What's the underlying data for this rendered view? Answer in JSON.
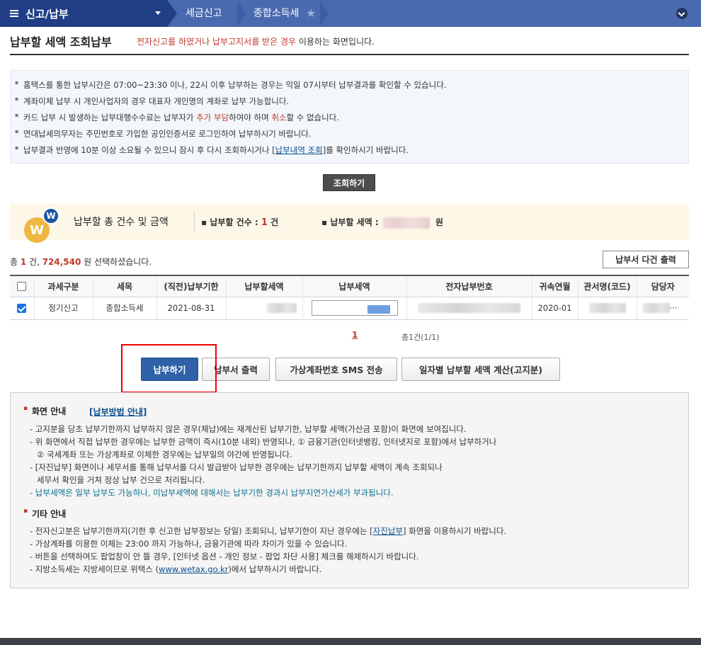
{
  "nav": {
    "main": "신고/납부",
    "crumbs": [
      "세금신고",
      "종합소득세"
    ]
  },
  "page": {
    "title": "납부할 세액 조회납부",
    "subtitle_red": "전자신고를 하였거나 납부고지서를 받은 경우",
    "subtitle_rest": " 이용하는 화면입니다."
  },
  "notice": {
    "line1": "홈택스를 통한 납부시간은 07:00~23:30 이나, 22시 이후 납부하는 경우는 익일 07시부터 납부결과를 확인할 수 있습니다.",
    "line2": "계좌이체 납부 시 개인사업자의 경우 대표자 개인명의 계좌로 납부 가능합니다.",
    "line3_a": "카드 납부 시 발생하는 납부대행수수료는 납부자가 ",
    "line3_b": "추가 부담",
    "line3_c": "하여야 하며 ",
    "line3_d": "취소",
    "line3_e": "할 수 없습니다.",
    "line4": "연대납세의무자는 주민번호로 가입한 공인인증서로 로그인하여 납부하시기 바랍니다.",
    "line5_a": "납부결과 반영에 10분 이상 소요될 수 있으니 잠시 후 다시 조회하시거나 [",
    "line5_link": "납부내역 조회",
    "line5_b": "]를 확인하시기 바랍니다."
  },
  "buttons": {
    "query": "조회하기",
    "multi_print": "납부서 다건 출력",
    "pay": "납부하기",
    "print": "납부서 출력",
    "sms": "가상계좌번호 SMS 전송",
    "daily_calc": "일자별 납부할 세액 계산(고지분)"
  },
  "summary": {
    "logo_big": "W",
    "logo_small": "W",
    "title": "납부할 총 건수 및 금액",
    "count_label": "납부할 건수 : ",
    "count_value": "1",
    "count_unit": " 건",
    "tax_label": "납부할 세액 : ",
    "tax_unit": "원"
  },
  "selection": {
    "prefix": "총 ",
    "count": "1",
    "mid": " 건, ",
    "amount": "724,540",
    "suffix": " 원 선택하셨습니다."
  },
  "table": {
    "headers": [
      "과세구분",
      "세목",
      "(직전)납부기한",
      "납부할세액",
      "납부세액",
      "전자납부번호",
      "귀속연월",
      "관서명(코드)",
      "담당자"
    ],
    "row": {
      "type": "정기신고",
      "item": "종합소득세",
      "due": "2021-08-31",
      "period": "2020-01",
      "manager_tail": "···"
    }
  },
  "pager": {
    "page": "1",
    "total": "총1건(1/1)"
  },
  "guide": {
    "section1": "화면 안내",
    "section1_link": "[납부방법 안내]",
    "g1": "- 고지분을 당초 납부기한까지 납부하지 않은 경우(체납)에는 재계산된 납부기한, 납부할 세액(가산금 포함)이 화면에 보여집니다.",
    "g2": "- 위 화면에서 직접 납부한 경우에는 납부한 금액이 즉시(10분 내외) 반영되나, ① 금융기관(인터넷뱅킹, 인터넷지로 포함)에서 납부하거나",
    "g3": "  ② 국세계좌 또는 가상계좌로 이체한 경우에는 납부일의 야간에 반영됩니다.",
    "g4": "- [자진납부] 화면이나 세무서를 통해 납부서를 다시 발급받아 납부한 경우에는 납부기한까지 납부할 세액이 계속 조회되나",
    "g5": "  세무서 확인을 거쳐 정상 납부 건으로 처리됩니다.",
    "g6": "- 납부세액은 일부 납부도 가능하나, 미납부세액에 대해서는 납부기한 경과시 납부지연가산세가 부과됩니다.",
    "section2": "기타 안내",
    "o1_a": "- 전자신고분은 납부기한까지(기한 후 신고한 납부정보는 당일) 조회되니, 납부기한이 지난 경우에는 [",
    "o1_link": "자진납부",
    "o1_b": "] 화면을 이용하시기 바랍니다.",
    "o2": "- 가상계좌를 이용한 이체는 23:00 까지 가능하나, 금융기관에 따라 차이가 있을 수 있습니다.",
    "o3": "- 버튼을 선택하여도 팝업창이 안 뜰 경우, [인터넷 옵션 - 개인 정보 - 팝업 차단 사용] 체크를 해제하시기 바랍니다.",
    "o4_a": "- 지방소득세는 지방세이므로 위택스 (",
    "o4_link": "www.wetax.go.kr",
    "o4_b": ")에서 납부하시기 바랍니다."
  }
}
